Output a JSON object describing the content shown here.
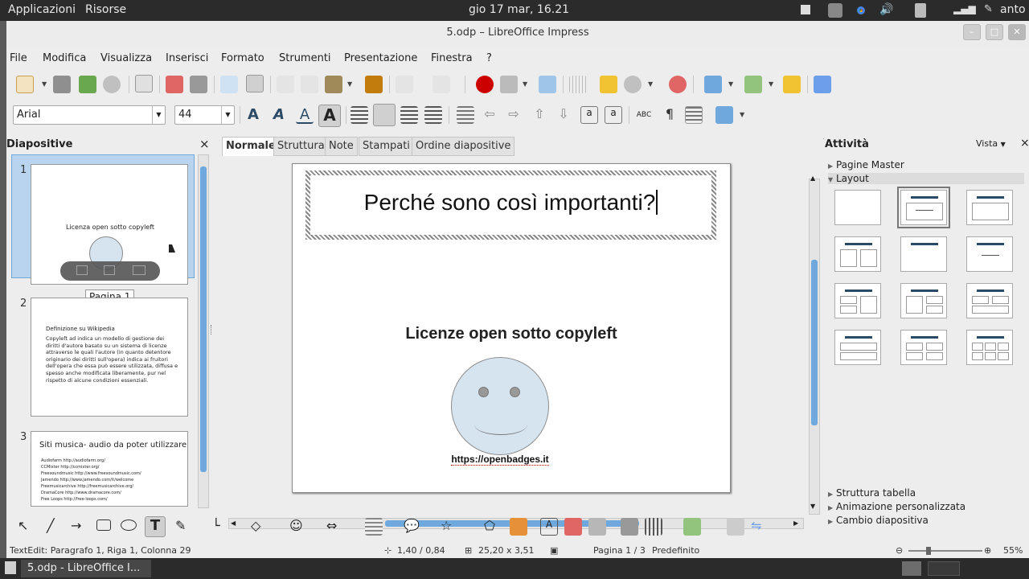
{
  "system": {
    "apps_menu": "Applicazioni",
    "places_menu": "Risorse",
    "clock": "gio 17 mar, 16.21",
    "user": "anto"
  },
  "window": {
    "title": "5.odp – LibreOffice Impress"
  },
  "menu": [
    "File",
    "Modifica",
    "Visualizza",
    "Inserisci",
    "Formato",
    "Strumenti",
    "Presentazione",
    "Finestra",
    "?"
  ],
  "format": {
    "font_name": "Arial",
    "font_size": "44"
  },
  "slides_panel": {
    "title": "Diapositive",
    "close": "×",
    "tooltip": "Pagina 1",
    "slides": [
      {
        "num": "1",
        "text": "Licenza open sotto copyleft"
      },
      {
        "num": "2",
        "heading": "Definizione su Wikipedia",
        "body": "Copyleft ad indica un modello di gestione dei diritti d'autore basato su un sistema di licenze attraverso le quali l'autore (in quanto detentore originario dei diritti sull'opera) indica ai fruitori dell'opera che essa può essere utilizzata, diffusa e spesso anche modificata liberamente, pur nel rispetto di alcune condizioni essenziali."
      },
      {
        "num": "3",
        "heading": "Siti musica- audio da poter utilizzare",
        "items": [
          "Audiofarm http://audiofarm.org/",
          "CCMixter http://ccmixter.org/",
          "Freesoundmusic http://www.freesoundmusic.com/",
          "Jamendo http://www.jamendo.com/it/welcome",
          "Freemusicarchive http://freemusicarchive.org/",
          "DramaCore http://www.dramacore.com/",
          "Free Loops http://free-loops.com/"
        ]
      }
    ]
  },
  "view_tabs": [
    "Normale",
    "Struttura",
    "Note",
    "Stampati",
    "Ordine diapositive"
  ],
  "slide": {
    "title": "Perché sono così importanti?",
    "subtitle": "Licenze open sotto copyleft",
    "link": "https://openbadges.it"
  },
  "tasks_panel": {
    "title": "Attività",
    "view_menu": "Vista",
    "sections_top": [
      "Pagine Master",
      "Layout"
    ],
    "sections_bottom": [
      "Struttura tabella",
      "Animazione personalizzata",
      "Cambio diapositiva"
    ]
  },
  "status": {
    "edit_info": "TextEdit: Paragrafo 1, Riga 1, Colonna 29",
    "position": "1,40 / 0,84",
    "size": "25,20 x 3,51",
    "page": "Pagina 1 / 3",
    "master": "Predefinito",
    "zoom": "55%"
  },
  "taskbar": {
    "window_label": "5.odp - LibreOffice I..."
  },
  "colors": {
    "accent": "#2b4a66",
    "selection": "#6fa8dc",
    "smiley": "#d6e4f0"
  }
}
